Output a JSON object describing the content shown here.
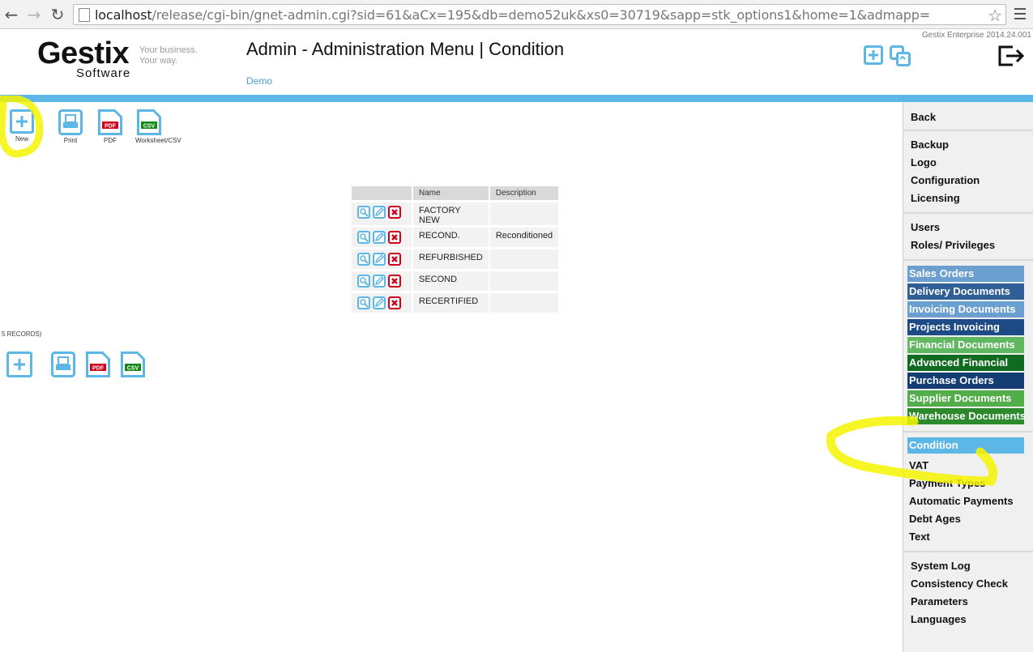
{
  "browser": {
    "url_host": "localhost",
    "url_path": "/release/cgi-bin/gnet-admin.cgi?sid=61&aCx=195&db=demo52uk&xs0=30719&sapp=stk_options1&home=1&admapp="
  },
  "header": {
    "version": "Gestix Enterprise 2014.24.001",
    "logo_main": "Gestix",
    "logo_sub": "Software",
    "logo_tag_1": "Your business.",
    "logo_tag_2": "Your way.",
    "title": "Admin - Administration Menu | Condition",
    "company": "Demo"
  },
  "toolbar": {
    "new": "New",
    "print": "Print",
    "pdf": "PDF",
    "csv": "Worksheet/CSV"
  },
  "table": {
    "columns": [
      "Name",
      "Description"
    ],
    "rows": [
      {
        "name": "FACTORY NEW",
        "description": ""
      },
      {
        "name": "RECOND.",
        "description": "Reconditioned"
      },
      {
        "name": "REFURBISHED",
        "description": ""
      },
      {
        "name": "SECOND",
        "description": ""
      },
      {
        "name": "RECERTIFIED",
        "description": ""
      }
    ]
  },
  "records_text": "5 RECORDS)",
  "sidebar": {
    "back": "Back",
    "group1": [
      "Backup",
      "Logo",
      "Configuration",
      "Licensing"
    ],
    "group2": [
      "Users",
      "Roles/ Privileges"
    ],
    "modules": [
      {
        "label": "Sales Orders",
        "color": "#6a9fd0"
      },
      {
        "label": "Delivery Documents",
        "color": "#2f5f96"
      },
      {
        "label": "Invoicing Documents",
        "color": "#6a9fd0"
      },
      {
        "label": "Projects Invoicing",
        "color": "#1e4a85"
      },
      {
        "label": "Financial Documents",
        "color": "#5fb85f"
      },
      {
        "label": "Advanced Financial",
        "color": "#0f6b1f"
      },
      {
        "label": "Purchase Orders",
        "color": "#133d73"
      },
      {
        "label": "Supplier Documents",
        "color": "#52ad48"
      },
      {
        "label": "Warehouse Documents",
        "color": "#2c8a2c"
      }
    ],
    "active": "Condition",
    "active_color": "#5cb7e6",
    "group3": [
      "VAT",
      "Payment Types",
      "Automatic Payments",
      "Debt Ages",
      "Text"
    ],
    "group4": [
      "System Log",
      "Consistency Check",
      "Parameters",
      "Languages"
    ]
  },
  "colors": {
    "accent": "#5cb7e6",
    "highlight": "#f5f500",
    "delete": "#d0021b"
  }
}
